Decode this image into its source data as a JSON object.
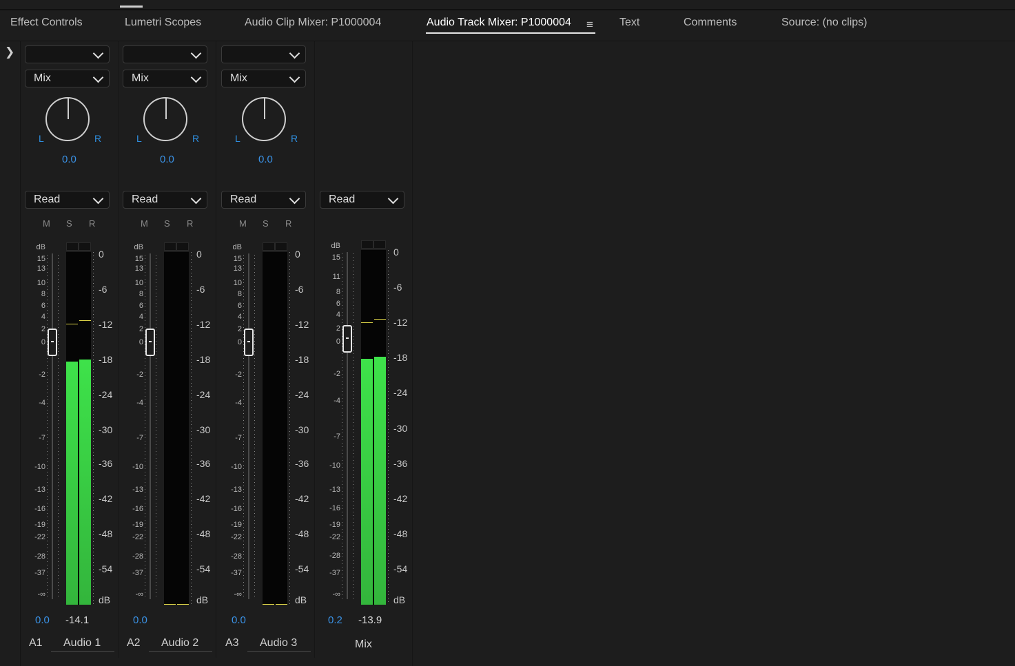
{
  "tabs": [
    {
      "label": "Effect Controls",
      "active": false
    },
    {
      "label": "Lumetri Scopes",
      "active": false
    },
    {
      "label": "Audio Clip Mixer: P1000004",
      "active": false
    },
    {
      "label": "Audio Track Mixer: P1000004",
      "active": true
    },
    {
      "label": "Text",
      "active": false
    },
    {
      "label": "Comments",
      "active": false
    },
    {
      "label": "Source: (no clips)",
      "active": false
    }
  ],
  "icons": {
    "tab_menu": "hamburger-menu-icon",
    "panel_toggle": "chevron-right-icon"
  },
  "colors": {
    "accent_blue": "#3a92e6",
    "meter_green": "#3ee24a",
    "peak_yellow": "#e2d94a"
  },
  "tracks": [
    {
      "id": "A1",
      "name": "Audio 1",
      "input_label": "",
      "mode": "Mix",
      "pan_l": "L",
      "pan_r": "R",
      "pan_value": "0.0",
      "automation": "Read",
      "m": "M",
      "s": "S",
      "r": "R",
      "volume": "0.0",
      "level": "-14.1"
    },
    {
      "id": "A2",
      "name": "Audio 2",
      "input_label": "",
      "mode": "Mix",
      "pan_l": "L",
      "pan_r": "R",
      "pan_value": "0.0",
      "automation": "Read",
      "m": "M",
      "s": "S",
      "r": "R",
      "volume": "0.0",
      "level": ""
    },
    {
      "id": "A3",
      "name": "Audio 3",
      "input_label": "",
      "mode": "Mix",
      "pan_l": "L",
      "pan_r": "R",
      "pan_value": "0.0",
      "automation": "Read",
      "m": "M",
      "s": "S",
      "r": "R",
      "volume": "0.0",
      "level": ""
    }
  ],
  "mix": {
    "name": "Mix",
    "automation": "Read",
    "volume": "0.2",
    "level": "-13.9"
  },
  "meter_levels_db": {
    "A1": {
      "left": -18.6,
      "right": -18.3,
      "peak_left": -12.2,
      "peak_right": -11.6
    },
    "A2": {
      "left": null,
      "right": null
    },
    "A3": {
      "left": null,
      "right": null
    },
    "Mix": {
      "left": -18.4,
      "right": -18.0,
      "peak_left": -12.2,
      "peak_right": -11.6
    }
  },
  "fader_scale": [
    "dB",
    "15",
    "13",
    "10",
    "8",
    "6",
    "4",
    "2",
    "0",
    "-2",
    "-4",
    "-7",
    "-10",
    "-13",
    "-16",
    "-19",
    "-22",
    "-28",
    "-37",
    "-∞"
  ],
  "mix_fader_scale": [
    "dB",
    "15",
    "11",
    "8",
    "6",
    "4",
    "2",
    "0",
    "-2",
    "-4",
    "-7",
    "-10",
    "-13",
    "-16",
    "-19",
    "-22",
    "-28",
    "-37",
    "-∞"
  ],
  "meter_scale": [
    "0",
    "-6",
    "-12",
    "-18",
    "-24",
    "-30",
    "-36",
    "-42",
    "-48",
    "-54",
    "dB"
  ]
}
